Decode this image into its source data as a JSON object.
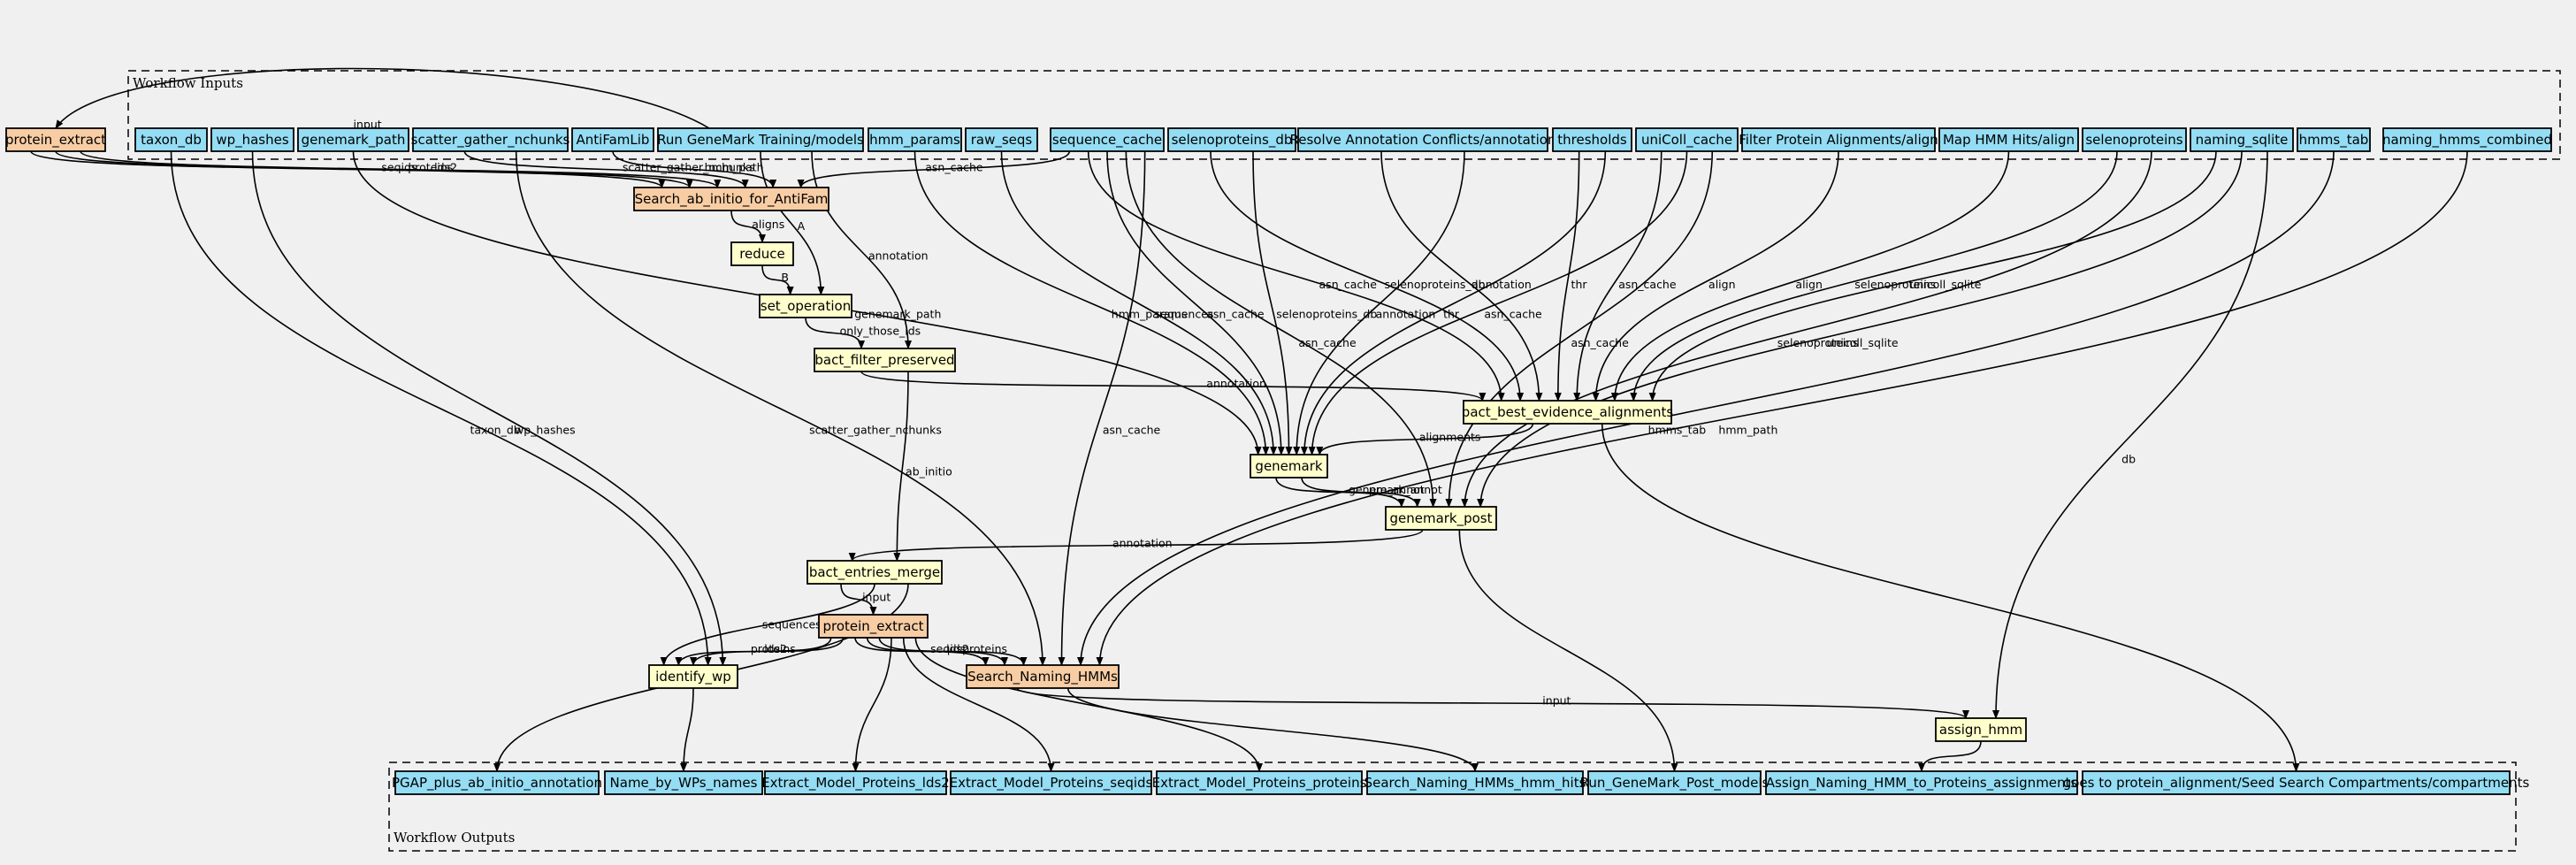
{
  "diagram": {
    "input_cluster_label": "Workflow Inputs",
    "output_cluster_label": "Workflow Outputs",
    "colors": {
      "background": "#f0f0f0",
      "input_fill": "#94ddf4",
      "step_fill": "#ffffcc",
      "subworkflow_fill": "#f8cda4",
      "stroke": "#000000"
    },
    "nodes": [
      {
        "id": "protein_extract_in",
        "label": "protein_extract",
        "kind": "subworkflow"
      },
      {
        "id": "taxon_db",
        "label": "taxon_db",
        "kind": "input"
      },
      {
        "id": "wp_hashes",
        "label": "wp_hashes",
        "kind": "input"
      },
      {
        "id": "genemark_path",
        "label": "genemark_path",
        "kind": "input"
      },
      {
        "id": "scatter_gather_nchunks",
        "label": "scatter_gather_nchunks",
        "kind": "input"
      },
      {
        "id": "AntiFamLib",
        "label": "AntiFamLib",
        "kind": "input"
      },
      {
        "id": "run_genemark_training",
        "label": "Run GeneMark Training/models",
        "kind": "input"
      },
      {
        "id": "hmm_params",
        "label": "hmm_params",
        "kind": "input"
      },
      {
        "id": "raw_seqs",
        "label": "raw_seqs",
        "kind": "input"
      },
      {
        "id": "sequence_cache",
        "label": "sequence_cache",
        "kind": "input"
      },
      {
        "id": "selenoproteins_db",
        "label": "selenoproteins_db",
        "kind": "input"
      },
      {
        "id": "resolve_conflicts",
        "label": "Resolve Annotation Conflicts/annotation",
        "kind": "input"
      },
      {
        "id": "thresholds",
        "label": "thresholds",
        "kind": "input"
      },
      {
        "id": "uniColl_cache",
        "label": "uniColl_cache",
        "kind": "input"
      },
      {
        "id": "filter_protein_align",
        "label": "Filter Protein Alignments/align",
        "kind": "input"
      },
      {
        "id": "map_hmm_hits",
        "label": "Map HMM Hits/align",
        "kind": "input"
      },
      {
        "id": "selenoproteins",
        "label": "selenoproteins",
        "kind": "input"
      },
      {
        "id": "naming_sqlite",
        "label": "naming_sqlite",
        "kind": "input"
      },
      {
        "id": "hmms_tab",
        "label": "hmms_tab",
        "kind": "input"
      },
      {
        "id": "naming_hmms_combined",
        "label": "naming_hmms_combined",
        "kind": "input"
      },
      {
        "id": "search_antifam",
        "label": "Search_ab_initio_for_AntiFam",
        "kind": "subworkflow"
      },
      {
        "id": "reduce",
        "label": "reduce",
        "kind": "step"
      },
      {
        "id": "set_operation",
        "label": "set_operation",
        "kind": "step"
      },
      {
        "id": "bact_filter_preserved",
        "label": "bact_filter_preserved",
        "kind": "step"
      },
      {
        "id": "bact_best_evidence",
        "label": "bact_best_evidence_alignments",
        "kind": "step"
      },
      {
        "id": "genemark",
        "label": "genemark",
        "kind": "step"
      },
      {
        "id": "genemark_post",
        "label": "genemark_post",
        "kind": "step"
      },
      {
        "id": "bact_entries_merge",
        "label": "bact_entries_merge",
        "kind": "step"
      },
      {
        "id": "protein_extract_mid",
        "label": "protein_extract",
        "kind": "subworkflow"
      },
      {
        "id": "identify_wp",
        "label": "identify_wp",
        "kind": "step"
      },
      {
        "id": "search_naming_hmms",
        "label": "Search_Naming_HMMs",
        "kind": "subworkflow"
      },
      {
        "id": "assign_hmm",
        "label": "assign_hmm",
        "kind": "step"
      },
      {
        "id": "out_pgap",
        "label": "PGAP_plus_ab_initio_annotation",
        "kind": "input"
      },
      {
        "id": "out_wp_names",
        "label": "Name_by_WPs_names",
        "kind": "input"
      },
      {
        "id": "out_lds2",
        "label": "Extract_Model_Proteins_lds2",
        "kind": "input"
      },
      {
        "id": "out_seqids",
        "label": "Extract_Model_Proteins_seqids",
        "kind": "input"
      },
      {
        "id": "out_proteins",
        "label": "Extract_Model_Proteins_proteins",
        "kind": "input"
      },
      {
        "id": "out_hmm_hits",
        "label": "Search_Naming_HMMs_hmm_hits",
        "kind": "input"
      },
      {
        "id": "out_genemark_post",
        "label": "Run_GeneMark_Post_models",
        "kind": "input"
      },
      {
        "id": "out_assign",
        "label": "Assign_Naming_HMM_to_Proteins_assignments",
        "kind": "input"
      },
      {
        "id": "out_compartments",
        "label": "goes to protein_alignment/Seed Search Compartments/compartments",
        "kind": "input"
      }
    ],
    "edges": [
      {
        "from": "run_genemark_training",
        "to": "protein_extract_in",
        "label": "input"
      },
      {
        "from": "protein_extract_in",
        "to": "search_antifam",
        "label": "seqids"
      },
      {
        "from": "protein_extract_in",
        "to": "search_antifam",
        "label": "proteins"
      },
      {
        "from": "protein_extract_in",
        "to": "search_antifam",
        "label": "lds2"
      },
      {
        "from": "scatter_gather_nchunks",
        "to": "search_antifam",
        "label": "scatter_gather_nchunks"
      },
      {
        "from": "AntiFamLib",
        "to": "search_antifam",
        "label": "hmm_path"
      },
      {
        "from": "sequence_cache",
        "to": "search_antifam",
        "label": "asn_cache"
      },
      {
        "from": "search_antifam",
        "to": "reduce",
        "label": "aligns"
      },
      {
        "from": "reduce",
        "to": "set_operation",
        "label": "B"
      },
      {
        "from": "run_genemark_training",
        "to": "set_operation",
        "label": "A"
      },
      {
        "from": "set_operation",
        "to": "bact_filter_preserved",
        "label": "only_those_ids"
      },
      {
        "from": "run_genemark_training",
        "to": "bact_filter_preserved",
        "label": "annotation"
      },
      {
        "from": "bact_filter_preserved",
        "to": "bact_best_evidence",
        "label": "annotation"
      },
      {
        "from": "sequence_cache",
        "to": "bact_best_evidence",
        "label": "asn_cache"
      },
      {
        "from": "selenoproteins_db",
        "to": "bact_best_evidence",
        "label": "selenoproteins_db"
      },
      {
        "from": "resolve_conflicts",
        "to": "bact_best_evidence",
        "label": "annotation"
      },
      {
        "from": "thresholds",
        "to": "bact_best_evidence",
        "label": "thr"
      },
      {
        "from": "uniColl_cache",
        "to": "bact_best_evidence",
        "label": "asn_cache"
      },
      {
        "from": "filter_protein_align",
        "to": "bact_best_evidence",
        "label": "align"
      },
      {
        "from": "map_hmm_hits",
        "to": "bact_best_evidence",
        "label": "align"
      },
      {
        "from": "selenoproteins",
        "to": "bact_best_evidence",
        "label": "selenoproteins"
      },
      {
        "from": "naming_sqlite",
        "to": "bact_best_evidence",
        "label": "unicoll_sqlite"
      },
      {
        "from": "genemark_path",
        "to": "genemark",
        "label": "genemark_path"
      },
      {
        "from": "hmm_params",
        "to": "genemark",
        "label": "hmm_params"
      },
      {
        "from": "raw_seqs",
        "to": "genemark",
        "label": "sequences"
      },
      {
        "from": "sequence_cache",
        "to": "genemark",
        "label": "asn_cache"
      },
      {
        "from": "selenoproteins_db",
        "to": "genemark",
        "label": "selenoproteins_db"
      },
      {
        "from": "resolve_conflicts",
        "to": "genemark",
        "label": "annotation"
      },
      {
        "from": "thresholds",
        "to": "genemark",
        "label": "thr"
      },
      {
        "from": "uniColl_cache",
        "to": "genemark",
        "label": "asn_cache"
      },
      {
        "from": "bact_best_evidence",
        "to": "genemark",
        "label": "alignments"
      },
      {
        "from": "genemark",
        "to": "genemark_post",
        "label": "genemark_annot"
      },
      {
        "from": "genemark",
        "to": "genemark_post",
        "label": "pre_annot"
      },
      {
        "from": "sequence_cache",
        "to": "genemark_post",
        "label": "asn_cache"
      },
      {
        "from": "uniColl_cache",
        "to": "genemark_post",
        "label": "asn_cache"
      },
      {
        "from": "selenoproteins",
        "to": "genemark_post",
        "label": "selenoproteins"
      },
      {
        "from": "naming_sqlite",
        "to": "genemark_post",
        "label": "unicoll_sqlite"
      },
      {
        "from": "genemark_post",
        "to": "bact_entries_merge",
        "label": "annotation"
      },
      {
        "from": "bact_filter_preserved",
        "to": "bact_entries_merge",
        "label": "ab_initio"
      },
      {
        "from": "bact_entries_merge",
        "to": "protein_extract_mid",
        "label": "input"
      },
      {
        "from": "bact_entries_merge",
        "to": "identify_wp",
        "label": "sequences"
      },
      {
        "from": "protein_extract_mid",
        "to": "identify_wp",
        "label": "proteins"
      },
      {
        "from": "protein_extract_mid",
        "to": "identify_wp",
        "label": "lds2"
      },
      {
        "from": "taxon_db",
        "to": "identify_wp",
        "label": "taxon_db"
      },
      {
        "from": "wp_hashes",
        "to": "identify_wp",
        "label": "wp_hashes"
      },
      {
        "from": "protein_extract_mid",
        "to": "search_naming_hmms",
        "label": "seqids"
      },
      {
        "from": "protein_extract_mid",
        "to": "search_naming_hmms",
        "label": "lds2"
      },
      {
        "from": "protein_extract_mid",
        "to": "search_naming_hmms",
        "label": "proteins"
      },
      {
        "from": "scatter_gather_nchunks",
        "to": "search_naming_hmms",
        "label": "scatter_gather_nchunks"
      },
      {
        "from": "sequence_cache",
        "to": "search_naming_hmms",
        "label": "asn_cache"
      },
      {
        "from": "hmms_tab",
        "to": "search_naming_hmms",
        "label": "hmms_tab"
      },
      {
        "from": "naming_hmms_combined",
        "to": "search_naming_hmms",
        "label": "hmm_path"
      },
      {
        "from": "search_naming_hmms",
        "to": "assign_hmm",
        "label": "input"
      },
      {
        "from": "naming_sqlite",
        "to": "assign_hmm",
        "label": "db"
      },
      {
        "from": "bact_entries_merge",
        "to": "out_pgap",
        "label": ""
      },
      {
        "from": "identify_wp",
        "to": "out_wp_names",
        "label": ""
      },
      {
        "from": "protein_extract_mid",
        "to": "out_lds2",
        "label": ""
      },
      {
        "from": "protein_extract_mid",
        "to": "out_seqids",
        "label": ""
      },
      {
        "from": "protein_extract_mid",
        "to": "out_proteins",
        "label": ""
      },
      {
        "from": "search_naming_hmms",
        "to": "out_hmm_hits",
        "label": ""
      },
      {
        "from": "genemark_post",
        "to": "out_genemark_post",
        "label": ""
      },
      {
        "from": "assign_hmm",
        "to": "out_assign",
        "label": ""
      },
      {
        "from": "bact_best_evidence",
        "to": "out_compartments",
        "label": ""
      }
    ]
  }
}
